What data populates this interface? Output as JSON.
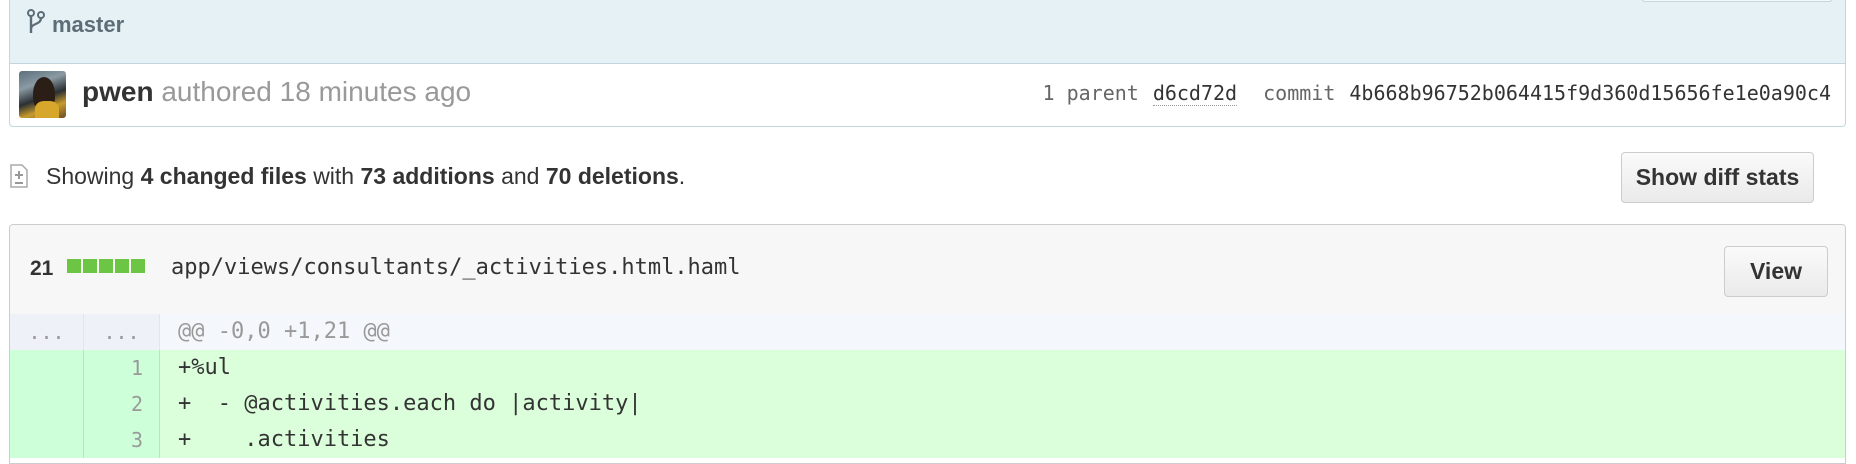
{
  "commit": {
    "branch": "master",
    "author_name": "pwen",
    "authored_text": "authored 18 minutes ago",
    "parent_label": "1 parent",
    "parent_sha": "d6cd72d",
    "commit_label": "commit",
    "commit_sha": "4b668b96752b064415f9d360d15656fe1e0a90c4"
  },
  "summary": {
    "prefix": "Showing",
    "files": "4 changed files",
    "with": "with",
    "additions": "73 additions",
    "and": "and",
    "deletions": "70 deletions",
    "suffix": ".",
    "diff_stats_button": "Show diff stats"
  },
  "file": {
    "change_count": "21",
    "path": "app/views/consultants/_activities.html.haml",
    "view_button": "View",
    "bar_color": "#6cc644"
  },
  "diff": {
    "hunk": {
      "left": "...",
      "right": "...",
      "text": "@@ -0,0 +1,21 @@"
    },
    "lines": [
      {
        "num": "1",
        "text": "+%ul"
      },
      {
        "num": "2",
        "text": "+  - @activities.each do |activity|"
      },
      {
        "num": "3",
        "text": "+    .activities"
      }
    ]
  },
  "icons": [
    "branch-icon",
    "file-diff-icon"
  ]
}
